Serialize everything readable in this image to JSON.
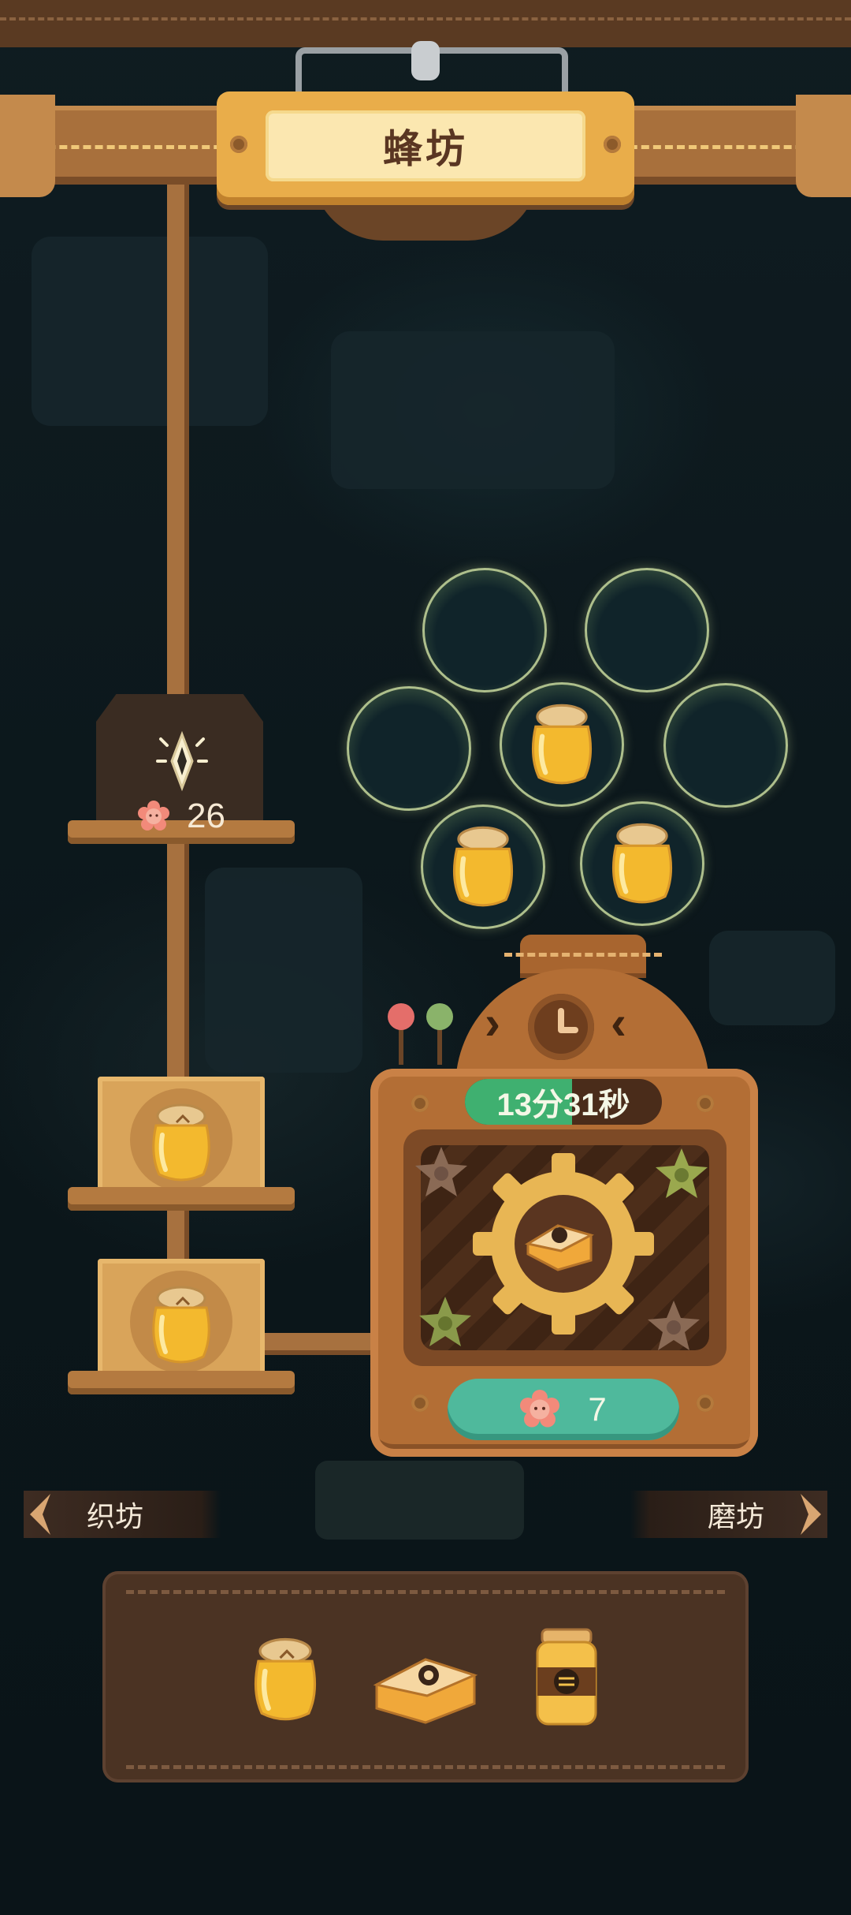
{
  "header": {
    "title": "蜂坊"
  },
  "locked_slot": {
    "cost": "26"
  },
  "machine": {
    "timer": "13分31秒",
    "collect_cost": "7"
  },
  "nav": {
    "left_label": "织坊",
    "right_label": "磨坊"
  },
  "bubbles": [
    {
      "state": "empty"
    },
    {
      "state": "empty"
    },
    {
      "state": "empty"
    },
    {
      "state": "honey"
    },
    {
      "state": "empty"
    },
    {
      "state": "honey"
    },
    {
      "state": "honey"
    }
  ],
  "queue": [
    {
      "item": "honey-jar"
    },
    {
      "item": "honey-jar"
    }
  ],
  "materials": [
    {
      "item": "honey-jar"
    },
    {
      "item": "honeycomb-cake"
    },
    {
      "item": "bee-jar"
    }
  ],
  "colors": {
    "wood": "#b36e35",
    "timer_green": "#3fb070",
    "button_teal": "#4fb99c",
    "title_plate": "#e9ad4a"
  }
}
